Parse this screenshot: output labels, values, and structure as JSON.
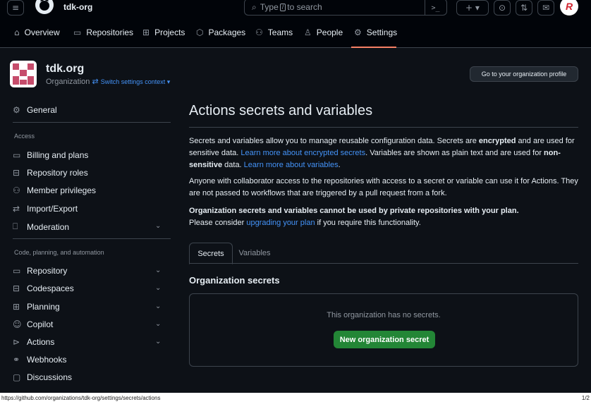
{
  "topbar": {
    "org_name": "tdk-org",
    "search_placeholder_pre": "Type",
    "search_slash": "/",
    "search_placeholder_post": "to search",
    "cmd_label": ">_",
    "plus_label": "+ ▾",
    "avatar_letter": "R"
  },
  "nav": {
    "items": [
      {
        "label": "Overview",
        "icon": "home-icon"
      },
      {
        "label": "Repositories",
        "icon": "repo-icon"
      },
      {
        "label": "Projects",
        "icon": "table-icon"
      },
      {
        "label": "Packages",
        "icon": "package-icon"
      },
      {
        "label": "Teams",
        "icon": "people-icon"
      },
      {
        "label": "People",
        "icon": "person-icon"
      },
      {
        "label": "Settings",
        "icon": "gear-icon"
      }
    ]
  },
  "org": {
    "name": "tdk.org",
    "type": "Organization",
    "switch_label": "Switch settings context ▾",
    "profile_button": "Go to your organization profile"
  },
  "sidebar": {
    "general": "General",
    "access_heading": "Access",
    "access_items": [
      {
        "label": "Billing and plans",
        "icon": "credit-card-icon"
      },
      {
        "label": "Repository roles",
        "icon": "id-badge-icon"
      },
      {
        "label": "Member privileges",
        "icon": "people-icon"
      },
      {
        "label": "Import/Export",
        "icon": "arrow-switch-icon"
      },
      {
        "label": "Moderation",
        "icon": "report-icon"
      }
    ],
    "code_heading": "Code, planning, and automation",
    "code_items": [
      {
        "label": "Repository",
        "icon": "repo-icon"
      },
      {
        "label": "Codespaces",
        "icon": "codespaces-icon"
      },
      {
        "label": "Planning",
        "icon": "table-icon"
      },
      {
        "label": "Copilot",
        "icon": "copilot-icon"
      },
      {
        "label": "Actions",
        "icon": "play-icon"
      },
      {
        "label": "Webhooks",
        "icon": "webhook-icon"
      },
      {
        "label": "Discussions",
        "icon": "comment-discussion-icon"
      }
    ]
  },
  "main": {
    "title": "Actions secrets and variables",
    "p1_a": "Secrets and variables allow you to manage reusable configuration data. Secrets are ",
    "p1_b": "encrypted",
    "p1_c": " and are used for sensitive data. ",
    "p1_link1": "Learn more about encrypted secrets",
    "p1_d": ". Variables are shown as plain text and are used for ",
    "p1_e": "non-sensitive",
    "p1_f": " data. ",
    "p1_link2": "Learn more about variables",
    "p1_g": ".",
    "p2": "Anyone with collaborator access to the repositories with access to a secret or variable can use it for Actions. They are not passed to workflows that are triggered by a pull request from a fork.",
    "p3_bold": "Organization secrets and variables cannot be used by private repositories with your plan.",
    "p3_a": "Please consider ",
    "p3_link": "upgrading your plan",
    "p3_b": " if you require this functionality.",
    "tabs": [
      {
        "label": "Secrets"
      },
      {
        "label": "Variables"
      }
    ],
    "section_title": "Organization secrets",
    "empty_text": "This organization has no secrets.",
    "new_button": "New organization secret"
  },
  "statusbar": {
    "url": "https://github.com/organizations/tdk-org/settings/secrets/actions",
    "page": "1/2"
  }
}
